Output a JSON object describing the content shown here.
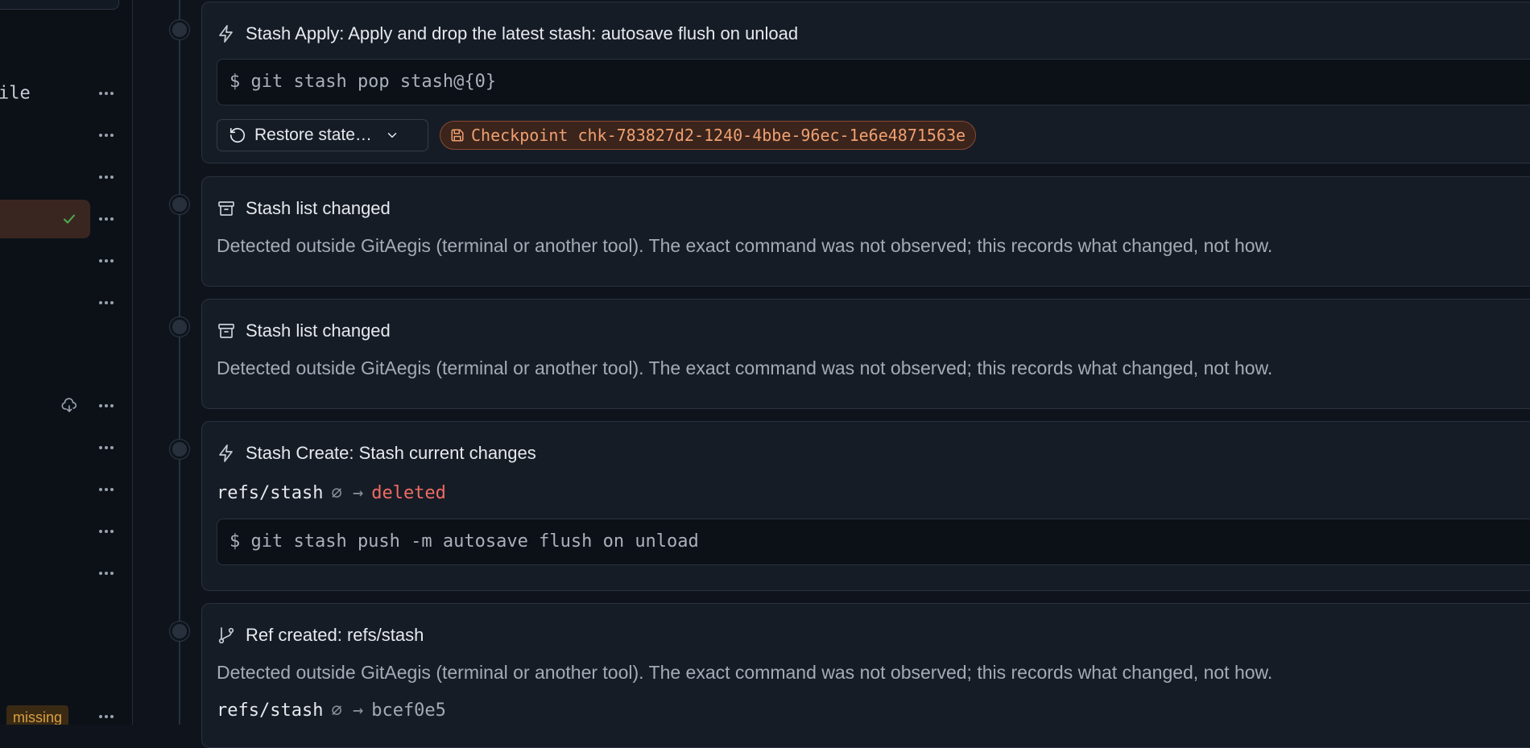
{
  "sidebar": {
    "rows": [
      {
        "label": "ile"
      },
      {
        "label": ""
      },
      {
        "label": ""
      },
      {
        "label": "",
        "active": true
      },
      {
        "label": ""
      },
      {
        "label": ""
      },
      {
        "label": ""
      },
      {
        "label": ""
      },
      {
        "label": ""
      },
      {
        "label": ""
      },
      {
        "label": ""
      }
    ],
    "missing_badge": "missing"
  },
  "timeline": [
    {
      "title": "Stash Apply: Apply and drop the latest stash: autosave flush on unload",
      "command": "$ git stash pop stash@{0}",
      "restore_label": "Restore state…",
      "checkpoint_label": "Checkpoint chk-783827d2-1240-4bbe-96ec-1e6e4871563e"
    },
    {
      "title": "Stash list changed",
      "description": "Detected outside GitAegis (terminal or another tool). The exact command was not observed; this records what changed, not how."
    },
    {
      "title": "Stash list changed",
      "description": "Detected outside GitAegis (terminal or another tool). The exact command was not observed; this records what changed, not how."
    },
    {
      "title": "Stash Create: Stash current changes",
      "ref": "refs/stash",
      "ref_change": "∅ →",
      "ref_result": "deleted",
      "command": "$ git stash push -m autosave flush on unload"
    },
    {
      "title": "Ref created: refs/stash",
      "description": "Detected outside GitAegis (terminal or another tool). The exact command was not observed; this records what changed, not how.",
      "ref": "refs/stash",
      "ref_change": "∅ →",
      "ref_result": "bcef0e5"
    }
  ],
  "colors": {
    "accent_checkpoint": "#f0a070",
    "deleted": "#ef6b62",
    "check": "#4caf50",
    "missing": "#d9a040"
  }
}
